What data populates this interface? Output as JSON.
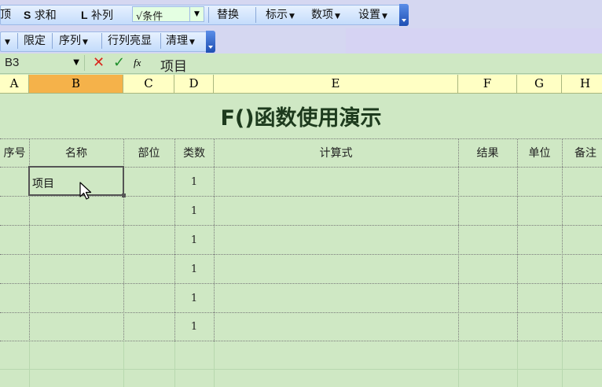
{
  "toolbar1": {
    "items": [
      "顶",
      "求和",
      "补列",
      "替换",
      "标示",
      "数项",
      "设置"
    ],
    "s_letter": "S",
    "l_letter": "L",
    "condition_value": "√条件"
  },
  "toolbar2": {
    "items": [
      "限定",
      "序列",
      "行列亮显",
      "清理"
    ]
  },
  "formula_bar": {
    "name_box": "B3",
    "fx_label": "fx",
    "value": "项目"
  },
  "columns": [
    "A",
    "B",
    "C",
    "D",
    "E",
    "F",
    "G",
    "H"
  ],
  "sheet": {
    "title": "F()函数使用演示",
    "headers": [
      "序号",
      "名称",
      "部位",
      "类数",
      "计算式",
      "结果",
      "单位",
      "备注"
    ],
    "active_cell_text": "项目",
    "type_count_values": [
      "1",
      "1",
      "1",
      "1",
      "1",
      "1"
    ]
  },
  "colors": {
    "sheet_bg": "#cfe8c4",
    "column_header_bg": "#ffffc4",
    "selected_column_bg": "#f5b24a"
  }
}
